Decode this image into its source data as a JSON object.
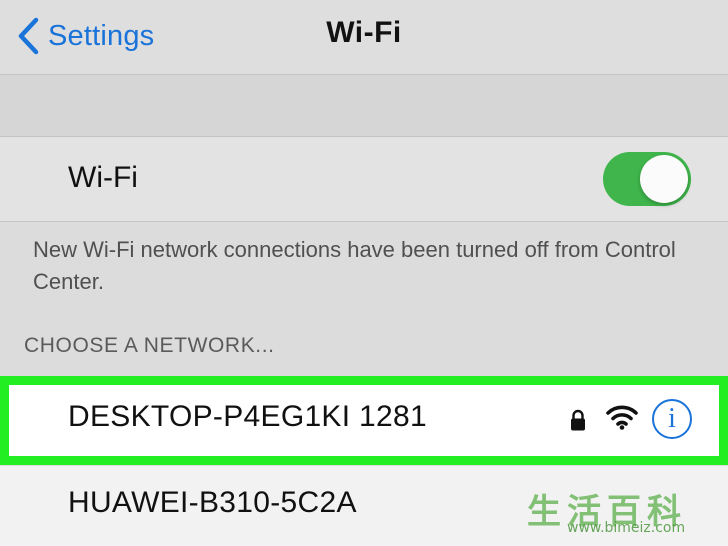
{
  "nav": {
    "back_label": "Settings",
    "title": "Wi-Fi"
  },
  "wifi": {
    "label": "Wi-Fi",
    "enabled": true,
    "footnote": "New Wi-Fi network connections have been turned off from Control Center."
  },
  "networks": {
    "section_header": "CHOOSE A NETWORK...",
    "items": [
      {
        "name": "DESKTOP-P4EG1KI 1281",
        "secured": true,
        "info_label": "i"
      },
      {
        "name": "HUAWEI-B310-5C2A"
      }
    ]
  },
  "watermark": {
    "chars": "生活百科",
    "url": "www.bimeiz.com"
  },
  "colors": {
    "accent": "#1a73d9",
    "toggle_on": "#3fb54b",
    "highlight": "#22ee22"
  },
  "icons": {
    "back": "chevron-left-icon",
    "lock": "lock-icon",
    "wifi": "wifi-signal-icon",
    "info": "info-icon"
  }
}
